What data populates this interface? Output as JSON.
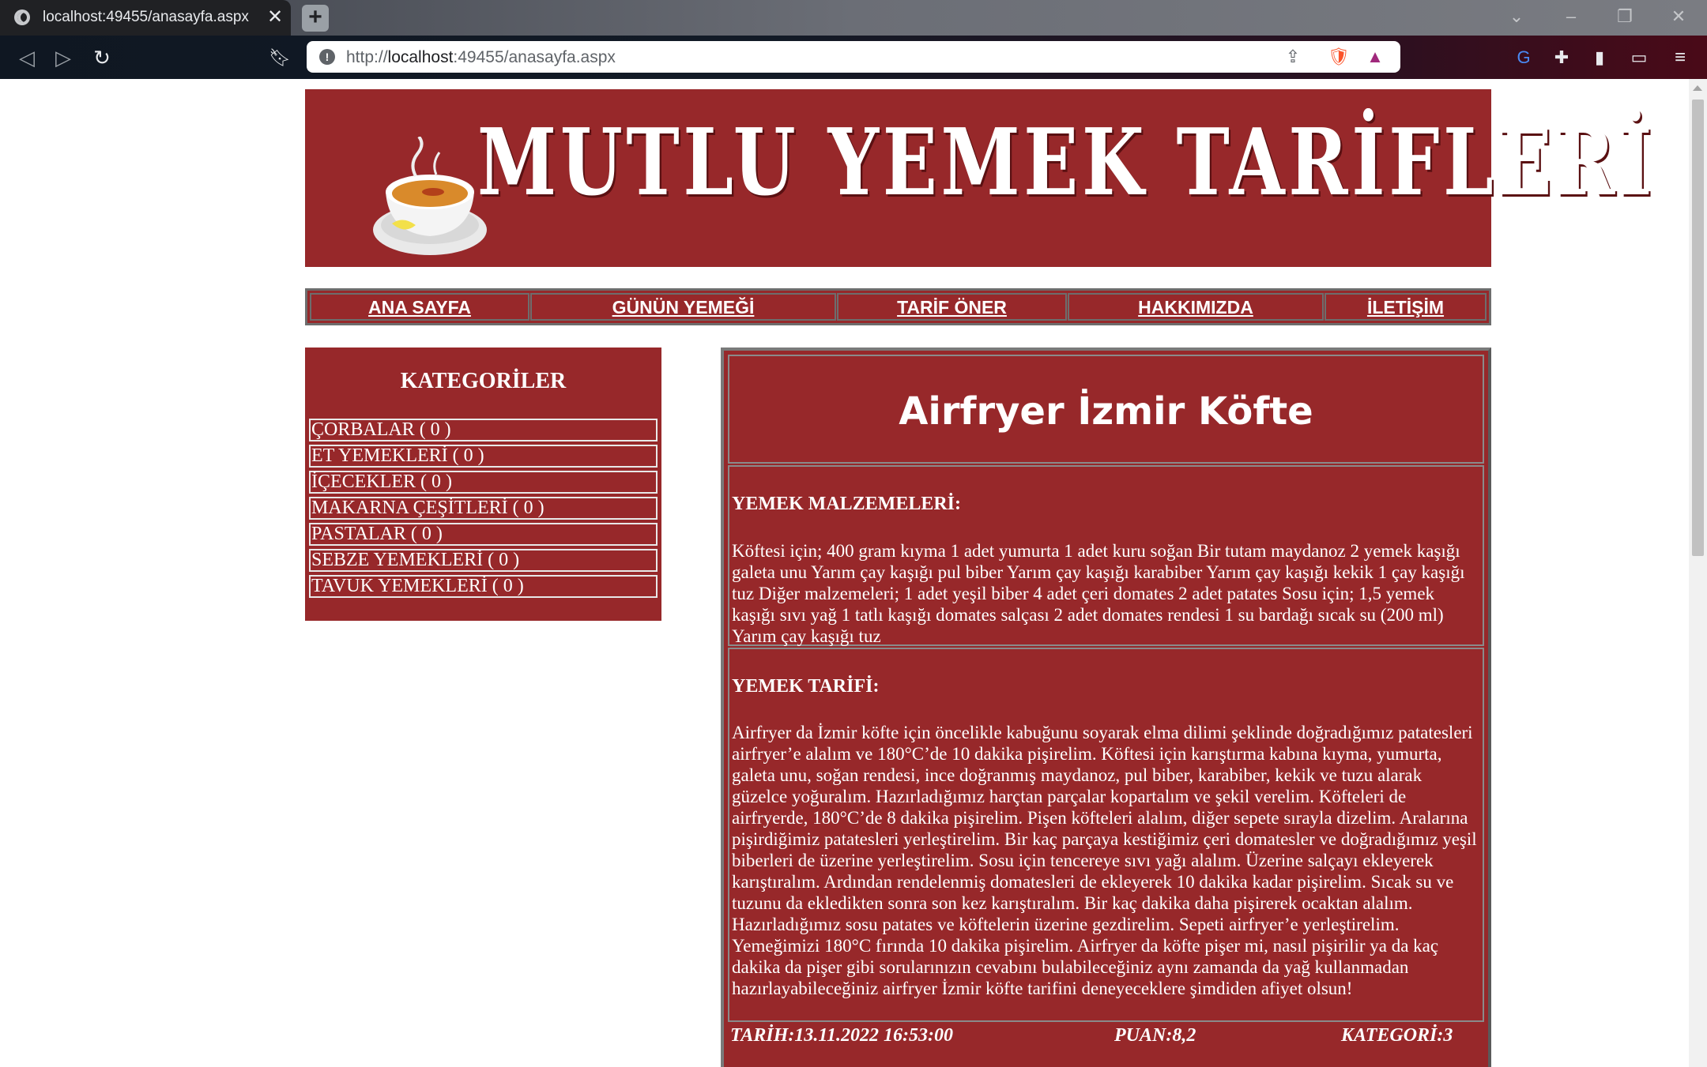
{
  "browser": {
    "tab_title": "localhost:49455/anasayfa.aspx",
    "url_prefix": "http://",
    "url_host": "localhost",
    "url_rest": ":49455/anasayfa.aspx"
  },
  "banner": {
    "title": "MUTLU  YEMEK  TARİFLERİ"
  },
  "nav": {
    "items": [
      "ANA SAYFA",
      "GÜNÜN YEMEĞİ",
      "TARİF ÖNER",
      "HAKKIMIZDA",
      "İLETİŞİM"
    ]
  },
  "categories": {
    "title": "KATEGORİLER",
    "items": [
      "ÇORBALAR  ( 0 )",
      "ET YEMEKLERİ  ( 0 )",
      "İÇECEKLER  ( 0 )",
      "MAKARNA ÇEŞİTLERİ  ( 0 )",
      "PASTALAR  ( 0 )",
      "SEBZE YEMEKLERİ  ( 0 )",
      "TAVUK YEMEKLERİ  ( 0 )"
    ]
  },
  "recipe": {
    "name": "Airfryer İzmir Köfte",
    "ingredients_heading": "YEMEK MALZEMELERİ:",
    "ingredients": "Köftesi için; 400 gram kıyma 1 adet yumurta 1 adet kuru soğan Bir tutam maydanoz 2 yemek kaşığı galeta unu Yarım çay kaşığı pul biber Yarım çay kaşığı karabiber Yarım çay kaşığı kekik 1 çay kaşığı tuz Diğer malzemeleri; 1 adet yeşil biber 4 adet çeri domates 2 adet patates Sosu için; 1,5 yemek kaşığı sıvı yağ 1 tatlı kaşığı domates salçası 2 adet domates rendesi 1 su bardağı sıcak su (200 ml) Yarım çay kaşığı tuz",
    "steps_heading": "YEMEK TARİFİ:",
    "steps": "Airfryer da İzmir köfte için öncelikle kabuğunu soyarak elma dilimi şeklinde doğradığımız patatesleri airfryer’e alalım ve 180°C’de 10 dakika pişirelim. Köftesi için karıştırma kabına kıyma, yumurta, galeta unu, soğan rendesi, ince doğranmış maydanoz, pul biber, karabiber, kekik ve tuzu alarak güzelce yoğuralım. Hazırladığımız harçtan parçalar kopartalım ve şekil verelim. Köfteleri de airfryerde, 180°C’de 8 dakika pişirelim. Pişen köfteleri alalım, diğer sepete sırayla dizelim. Aralarına pişirdiğimiz patatesleri yerleştirelim. Bir kaç parçaya kestiğimiz çeri domatesler ve doğradığımız yeşil biberleri de üzerine yerleştirelim. Sosu için tencereye sıvı yağı alalım. Üzerine salçayı ekleyerek karıştıralım. Ardından rendelenmiş domatesleri de ekleyerek 10 dakika kadar pişirelim. Sıcak su ve tuzunu da ekledikten sonra son kez karıştıralım. Bir kaç dakika daha pişirerek ocaktan alalım. Hazırladığımız sosu patates ve köftelerin üzerine gezdirelim. Sepeti airfryer’e yerleştirelim. Yemeğimizi 180°C fırında 10 dakika pişirelim. Airfryer da köfte pişer mi, nasıl pişirilir ya da kaç dakika da pişer gibi sorularınızın cevabını bulabileceğiniz aynı zamanda da yağ kullanmadan hazırlayabileceğiniz airfryer İzmir köfte tarifini deneyeceklere şimdiden afiyet olsun!",
    "date": "TARİH:13.11.2022 16:53:00",
    "score": "PUAN:8,2",
    "category": "KATEGORİ:3"
  },
  "colors": {
    "brand_red": "#97282a",
    "border_gray": "#6d6d6d"
  }
}
